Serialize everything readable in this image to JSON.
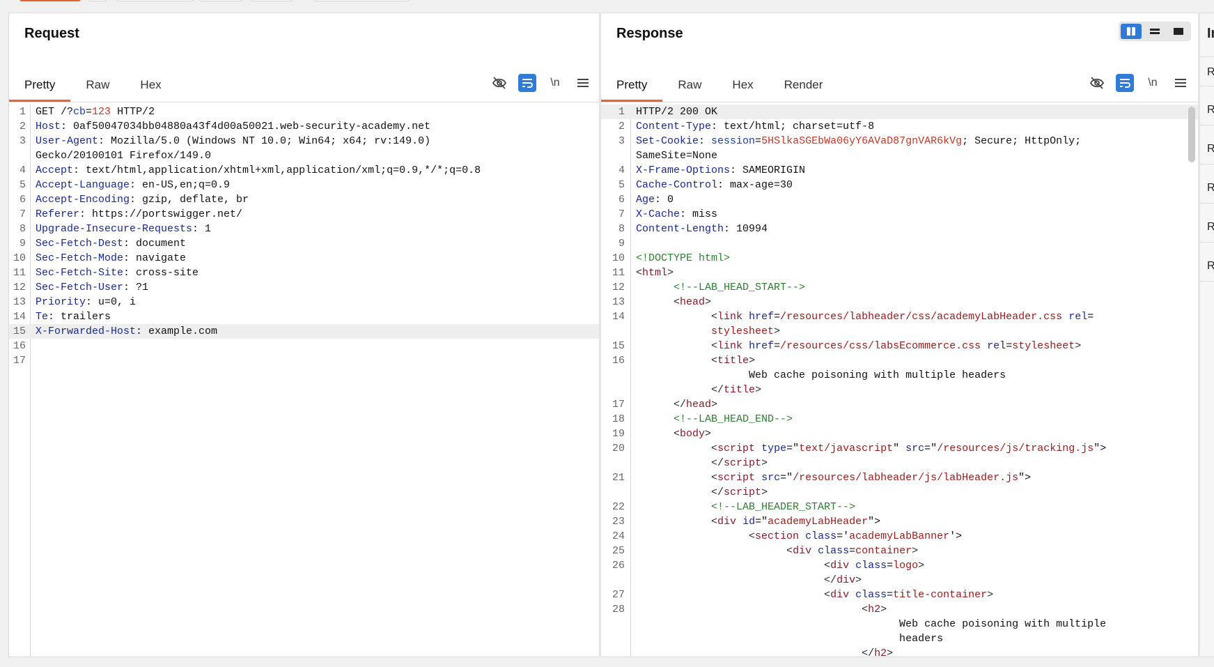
{
  "request": {
    "title": "Request",
    "tabs": [
      "Pretty",
      "Raw",
      "Hex"
    ],
    "active_tab": "Pretty",
    "lines": [
      {
        "n": "1",
        "parts": [
          [
            "",
            "GET /?"
          ],
          [
            "b",
            "cb"
          ],
          [
            "",
            "="
          ],
          [
            "r",
            "123"
          ],
          [
            "",
            " HTTP/2"
          ]
        ]
      },
      {
        "n": "2",
        "parts": [
          [
            "k",
            "Host"
          ],
          [
            "",
            ": 0af50047034bb04880a43f4d00a50021.web-security-academy.net"
          ]
        ]
      },
      {
        "n": "3",
        "parts": [
          [
            "k",
            "User-Agent"
          ],
          [
            "",
            ": Mozilla/5.0 (Windows NT 10.0; Win64; x64; rv:149.0)"
          ]
        ]
      },
      {
        "n": "",
        "parts": [
          [
            "",
            "Gecko/20100101 Firefox/149.0"
          ]
        ]
      },
      {
        "n": "4",
        "parts": [
          [
            "k",
            "Accept"
          ],
          [
            "",
            ": text/html,application/xhtml+xml,application/xml;q=0.9,*/*;q=0.8"
          ]
        ]
      },
      {
        "n": "5",
        "parts": [
          [
            "k",
            "Accept-Language"
          ],
          [
            "",
            ": en-US,en;q=0.9"
          ]
        ]
      },
      {
        "n": "6",
        "parts": [
          [
            "k",
            "Accept-Encoding"
          ],
          [
            "",
            ": gzip, deflate, br"
          ]
        ]
      },
      {
        "n": "7",
        "parts": [
          [
            "k",
            "Referer"
          ],
          [
            "",
            ": https://portswigger.net/"
          ]
        ]
      },
      {
        "n": "8",
        "parts": [
          [
            "k",
            "Upgrade-Insecure-Requests"
          ],
          [
            "",
            ": 1"
          ]
        ]
      },
      {
        "n": "9",
        "parts": [
          [
            "k",
            "Sec-Fetch-Dest"
          ],
          [
            "",
            ": document"
          ]
        ]
      },
      {
        "n": "10",
        "parts": [
          [
            "k",
            "Sec-Fetch-Mode"
          ],
          [
            "",
            ": navigate"
          ]
        ]
      },
      {
        "n": "11",
        "parts": [
          [
            "k",
            "Sec-Fetch-Site"
          ],
          [
            "",
            ": cross-site"
          ]
        ]
      },
      {
        "n": "12",
        "parts": [
          [
            "k",
            "Sec-Fetch-User"
          ],
          [
            "",
            ": ?1"
          ]
        ]
      },
      {
        "n": "13",
        "parts": [
          [
            "k",
            "Priority"
          ],
          [
            "",
            ": u=0, i"
          ]
        ]
      },
      {
        "n": "14",
        "parts": [
          [
            "k",
            "Te"
          ],
          [
            "",
            ": trailers"
          ]
        ]
      },
      {
        "n": "15",
        "hl": true,
        "parts": [
          [
            "k",
            "X-Forwarded-Host"
          ],
          [
            "",
            ": example.com"
          ]
        ]
      },
      {
        "n": "16",
        "parts": [
          [
            "",
            ""
          ]
        ]
      },
      {
        "n": "17",
        "parts": [
          [
            "",
            ""
          ]
        ]
      }
    ]
  },
  "response": {
    "title": "Response",
    "tabs": [
      "Pretty",
      "Raw",
      "Hex",
      "Render"
    ],
    "active_tab": "Pretty",
    "lines": [
      {
        "n": "1",
        "hl": true,
        "parts": [
          [
            "",
            "HTTP/2 200 OK"
          ]
        ]
      },
      {
        "n": "2",
        "parts": [
          [
            "k",
            "Content-Type"
          ],
          [
            "",
            ": text/html; charset=utf-8"
          ]
        ]
      },
      {
        "n": "3",
        "parts": [
          [
            "k",
            "Set-Cookie"
          ],
          [
            "",
            ": "
          ],
          [
            "b",
            "session"
          ],
          [
            "",
            "="
          ],
          [
            "r",
            "5HSlkaSGEbWa06yY6AVaD87gnVAR6kVg"
          ],
          [
            "",
            "; Secure; HttpOnly;"
          ]
        ]
      },
      {
        "n": "",
        "parts": [
          [
            "",
            "SameSite=None"
          ]
        ]
      },
      {
        "n": "4",
        "parts": [
          [
            "k",
            "X-Frame-Options"
          ],
          [
            "",
            ": SAMEORIGIN"
          ]
        ]
      },
      {
        "n": "5",
        "parts": [
          [
            "k",
            "Cache-Control"
          ],
          [
            "",
            ": max-age=30"
          ]
        ]
      },
      {
        "n": "6",
        "parts": [
          [
            "k",
            "Age"
          ],
          [
            "",
            ": 0"
          ]
        ]
      },
      {
        "n": "7",
        "parts": [
          [
            "k",
            "X-Cache"
          ],
          [
            "",
            ": miss"
          ]
        ]
      },
      {
        "n": "8",
        "parts": [
          [
            "k",
            "Content-Length"
          ],
          [
            "",
            ": 10994"
          ]
        ]
      },
      {
        "n": "9",
        "parts": [
          [
            "",
            ""
          ]
        ]
      },
      {
        "n": "10",
        "parts": [
          [
            "cmt",
            "<!DOCTYPE html>"
          ]
        ]
      },
      {
        "n": "11",
        "parts": [
          [
            "dt",
            "<"
          ],
          [
            "tag",
            "html"
          ],
          [
            "dt",
            ">"
          ]
        ]
      },
      {
        "n": "12",
        "parts": [
          [
            "",
            "      "
          ],
          [
            "cmt",
            "<!--LAB_HEAD_START-->"
          ]
        ]
      },
      {
        "n": "13",
        "parts": [
          [
            "",
            "      "
          ],
          [
            "dt",
            "<"
          ],
          [
            "tag",
            "head"
          ],
          [
            "dt",
            ">"
          ]
        ]
      },
      {
        "n": "14",
        "parts": [
          [
            "",
            "            "
          ],
          [
            "dt",
            "<"
          ],
          [
            "tag",
            "link"
          ],
          [
            "",
            " "
          ],
          [
            "attr",
            "href"
          ],
          [
            "",
            "="
          ],
          [
            "val",
            "/resources/labheader/css/academyLabHeader.css"
          ],
          [
            "",
            " "
          ],
          [
            "attr",
            "rel"
          ],
          [
            "",
            "="
          ]
        ]
      },
      {
        "n": "",
        "parts": [
          [
            "",
            "            "
          ],
          [
            "val",
            "stylesheet"
          ],
          [
            "dt",
            ">"
          ]
        ]
      },
      {
        "n": "15",
        "parts": [
          [
            "",
            "            "
          ],
          [
            "dt",
            "<"
          ],
          [
            "tag",
            "link"
          ],
          [
            "",
            " "
          ],
          [
            "attr",
            "href"
          ],
          [
            "",
            "="
          ],
          [
            "val",
            "/resources/css/labsEcommerce.css"
          ],
          [
            "",
            " "
          ],
          [
            "attr",
            "rel"
          ],
          [
            "",
            "="
          ],
          [
            "val",
            "stylesheet"
          ],
          [
            "dt",
            ">"
          ]
        ]
      },
      {
        "n": "16",
        "parts": [
          [
            "",
            "            "
          ],
          [
            "dt",
            "<"
          ],
          [
            "tag",
            "title"
          ],
          [
            "dt",
            ">"
          ]
        ]
      },
      {
        "n": "",
        "parts": [
          [
            "",
            "                  Web cache poisoning with multiple headers"
          ]
        ]
      },
      {
        "n": "",
        "parts": [
          [
            "",
            "            "
          ],
          [
            "dt",
            "</"
          ],
          [
            "tag",
            "title"
          ],
          [
            "dt",
            ">"
          ]
        ]
      },
      {
        "n": "17",
        "parts": [
          [
            "",
            "      "
          ],
          [
            "dt",
            "</"
          ],
          [
            "tag",
            "head"
          ],
          [
            "dt",
            ">"
          ]
        ]
      },
      {
        "n": "18",
        "parts": [
          [
            "",
            "      "
          ],
          [
            "cmt",
            "<!--LAB_HEAD_END-->"
          ]
        ]
      },
      {
        "n": "19",
        "parts": [
          [
            "",
            "      "
          ],
          [
            "dt",
            "<"
          ],
          [
            "tag",
            "body"
          ],
          [
            "dt",
            ">"
          ]
        ]
      },
      {
        "n": "20",
        "parts": [
          [
            "",
            "            "
          ],
          [
            "dt",
            "<"
          ],
          [
            "tag",
            "script"
          ],
          [
            "",
            " "
          ],
          [
            "attr",
            "type"
          ],
          [
            "",
            "=\""
          ],
          [
            "val",
            "text/javascript"
          ],
          [
            "",
            "\" "
          ],
          [
            "attr",
            "src"
          ],
          [
            "",
            "=\""
          ],
          [
            "val",
            "/resources/js/tracking.js"
          ],
          [
            "",
            "\">"
          ]
        ]
      },
      {
        "n": "",
        "parts": [
          [
            "",
            "            "
          ],
          [
            "dt",
            "</"
          ],
          [
            "tag",
            "script"
          ],
          [
            "dt",
            ">"
          ]
        ]
      },
      {
        "n": "21",
        "parts": [
          [
            "",
            "            "
          ],
          [
            "dt",
            "<"
          ],
          [
            "tag",
            "script"
          ],
          [
            "",
            " "
          ],
          [
            "attr",
            "src"
          ],
          [
            "",
            "=\""
          ],
          [
            "val",
            "/resources/labheader/js/labHeader.js"
          ],
          [
            "",
            "\">"
          ]
        ]
      },
      {
        "n": "",
        "parts": [
          [
            "",
            "            "
          ],
          [
            "dt",
            "</"
          ],
          [
            "tag",
            "script"
          ],
          [
            "dt",
            ">"
          ]
        ]
      },
      {
        "n": "22",
        "parts": [
          [
            "",
            "            "
          ],
          [
            "cmt",
            "<!--LAB_HEADER_START-->"
          ]
        ]
      },
      {
        "n": "23",
        "parts": [
          [
            "",
            "            "
          ],
          [
            "dt",
            "<"
          ],
          [
            "tag",
            "div"
          ],
          [
            "",
            " "
          ],
          [
            "attr",
            "id"
          ],
          [
            "",
            "=\""
          ],
          [
            "val",
            "academyLabHeader"
          ],
          [
            "",
            "\">"
          ]
        ]
      },
      {
        "n": "24",
        "parts": [
          [
            "",
            "                  "
          ],
          [
            "dt",
            "<"
          ],
          [
            "tag",
            "section"
          ],
          [
            "",
            " "
          ],
          [
            "attr",
            "class"
          ],
          [
            "",
            "='"
          ],
          [
            "val",
            "academyLabBanner"
          ],
          [
            "",
            "'>"
          ]
        ]
      },
      {
        "n": "25",
        "parts": [
          [
            "",
            "                        "
          ],
          [
            "dt",
            "<"
          ],
          [
            "tag",
            "div"
          ],
          [
            "",
            " "
          ],
          [
            "attr",
            "class"
          ],
          [
            "",
            "="
          ],
          [
            "val",
            "container"
          ],
          [
            "dt",
            ">"
          ]
        ]
      },
      {
        "n": "26",
        "parts": [
          [
            "",
            "                              "
          ],
          [
            "dt",
            "<"
          ],
          [
            "tag",
            "div"
          ],
          [
            "",
            " "
          ],
          [
            "attr",
            "class"
          ],
          [
            "",
            "="
          ],
          [
            "val",
            "logo"
          ],
          [
            "dt",
            ">"
          ]
        ]
      },
      {
        "n": "",
        "parts": [
          [
            "",
            "                              "
          ],
          [
            "dt",
            "</"
          ],
          [
            "tag",
            "div"
          ],
          [
            "dt",
            ">"
          ]
        ]
      },
      {
        "n": "27",
        "parts": [
          [
            "",
            "                              "
          ],
          [
            "dt",
            "<"
          ],
          [
            "tag",
            "div"
          ],
          [
            "",
            " "
          ],
          [
            "attr",
            "class"
          ],
          [
            "",
            "="
          ],
          [
            "val",
            "title-container"
          ],
          [
            "dt",
            ">"
          ]
        ]
      },
      {
        "n": "28",
        "parts": [
          [
            "",
            "                                    "
          ],
          [
            "dt",
            "<"
          ],
          [
            "tag",
            "h2"
          ],
          [
            "dt",
            ">"
          ]
        ]
      },
      {
        "n": "",
        "parts": [
          [
            "",
            "                                          Web cache poisoning with multiple"
          ]
        ]
      },
      {
        "n": "",
        "parts": [
          [
            "",
            "                                          headers"
          ]
        ]
      },
      {
        "n": "",
        "parts": [
          [
            "",
            "                                    "
          ],
          [
            "dt",
            "</"
          ],
          [
            "tag",
            "h2"
          ],
          [
            "dt",
            ">"
          ]
        ]
      }
    ]
  },
  "inspector": {
    "title": "In",
    "items": [
      "Re",
      "Re",
      "Re",
      "Re",
      "Re",
      "Re"
    ]
  },
  "icons": {
    "hide": "eye-off-icon",
    "wrap": "word-wrap-icon",
    "newline": "\\n",
    "menu": "hamburger-icon"
  }
}
